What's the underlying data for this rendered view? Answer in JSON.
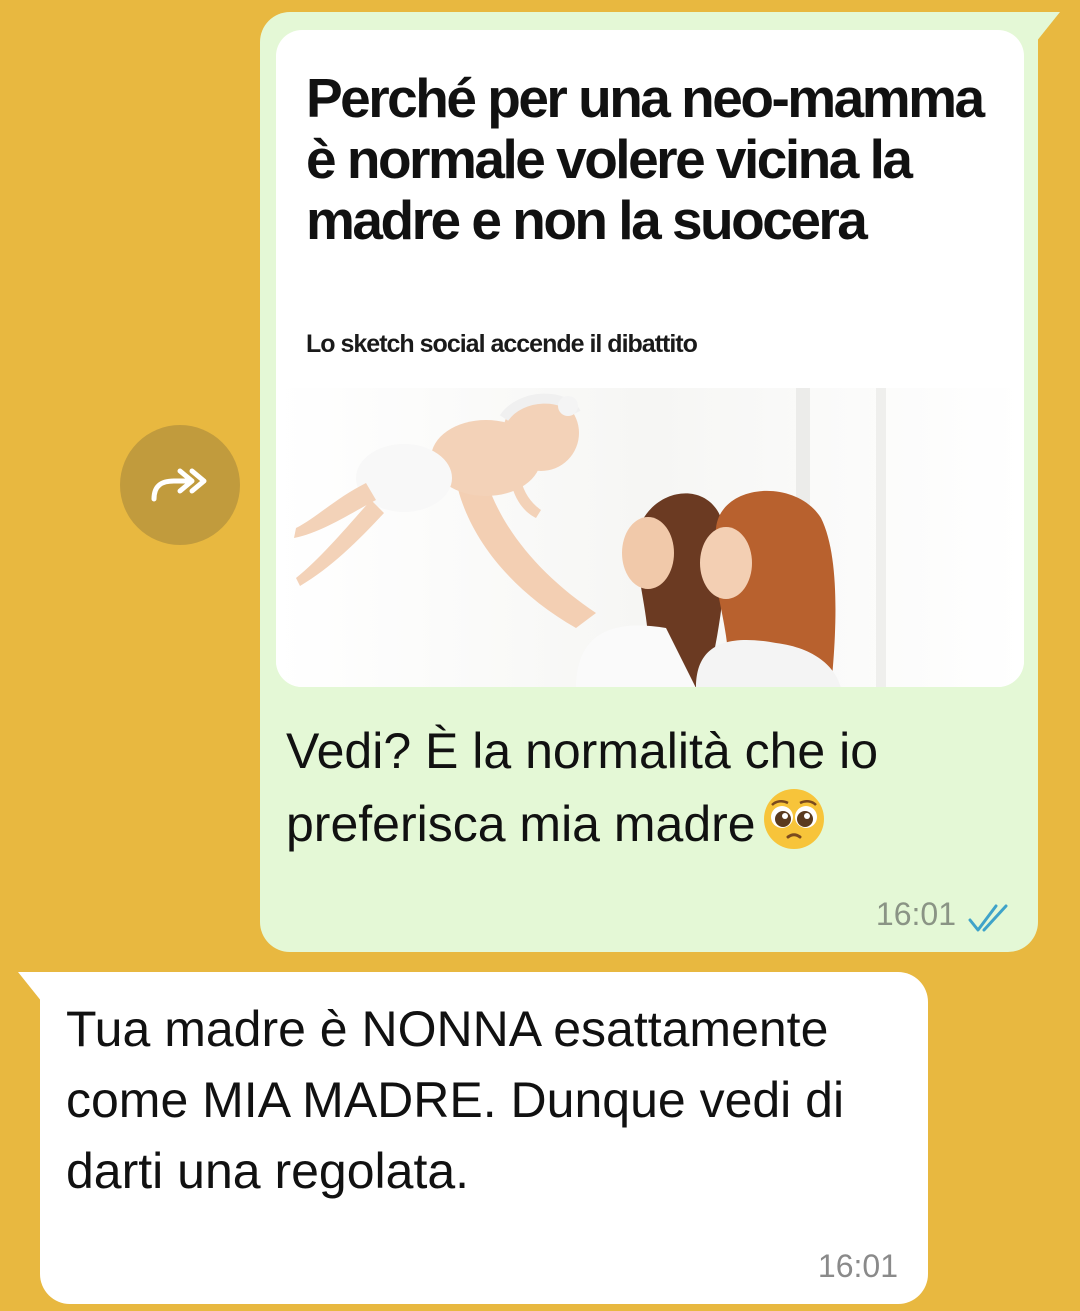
{
  "outgoing": {
    "preview": {
      "title": "Perché per una neo-mamma è normale volere vicina la madre e non la suocera",
      "subtitle": "Lo sketch social accende il dibattito"
    },
    "text": "Vedi? È la normalità che io preferisca mia madre",
    "emoji": "pleading-face-emoji",
    "time": "16:01",
    "status_icon": "double-check-read-icon"
  },
  "forward_icon": "forward-icon",
  "incoming": {
    "text": "Tua madre è NONNA esattamente come MIA MADRE. Dunque vedi di darti una regolata.",
    "time": "16:01"
  },
  "colors": {
    "chat_background": "#e8b840",
    "outgoing_bubble": "#e4f8d6",
    "incoming_bubble": "#ffffff",
    "read_ticks": "#3fa3c9",
    "forward_button": "#c19b3d"
  }
}
